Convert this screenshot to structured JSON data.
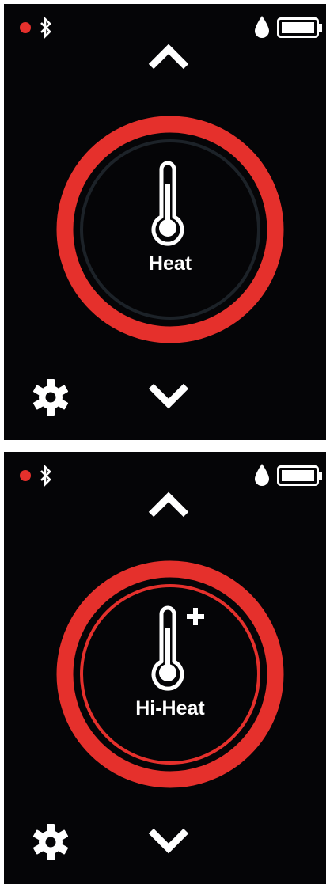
{
  "colors": {
    "accent": "#e5302c",
    "background": "#050507",
    "foreground": "#ffffff",
    "inner_ring_dim": "#1c2228"
  },
  "screens": [
    {
      "mode": {
        "label": "Heat",
        "icon": "thermometer-icon"
      },
      "icons": [
        "status-dot",
        "bluetooth-icon",
        "water-drop-icon",
        "battery-icon",
        "arrow-up-icon",
        "arrow-down-icon",
        "gear-icon"
      ]
    },
    {
      "mode": {
        "label": "Hi-Heat",
        "icon": "thermometer-plus-icon"
      },
      "icons": [
        "status-dot",
        "bluetooth-icon",
        "water-drop-icon",
        "battery-icon",
        "arrow-up-icon",
        "arrow-down-icon",
        "gear-icon"
      ]
    }
  ]
}
